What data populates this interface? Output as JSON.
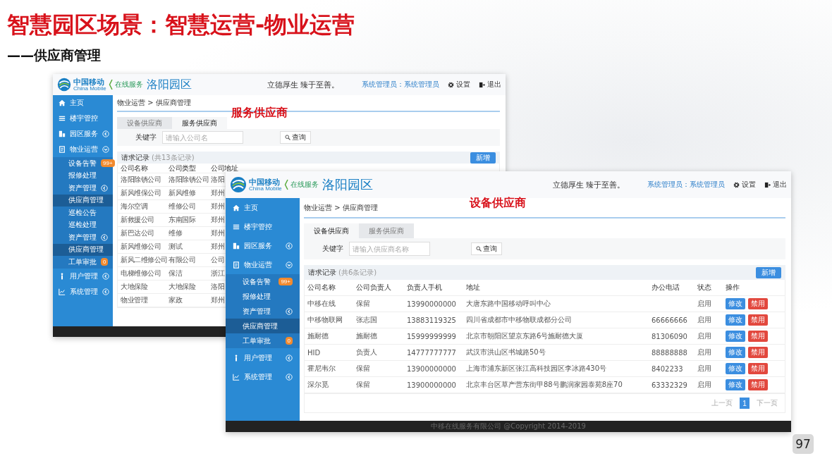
{
  "slide": {
    "title": "智慧园区场景：智慧运营-物业运营",
    "subtitle": "——供应商管理",
    "captions": [
      "服务供应商",
      "设备供应商"
    ],
    "page_number": "97"
  },
  "windows": [
    {
      "brand": {
        "name": "中国移动",
        "name_en": "China Mobile",
        "service": "在线服务",
        "park": "洛阳园区"
      },
      "slogan": "立德厚生 臻于至善。",
      "user": "系统管理员：系统管理员",
      "settings": "设置",
      "logout": "退出",
      "sidebar": [
        {
          "label": "主页",
          "selected": false
        },
        {
          "label": "楼宇管控",
          "selected": false
        },
        {
          "label": "园区服务",
          "selected": false,
          "expanded": false
        },
        {
          "label": "物业运营",
          "selected": false,
          "expanded": true,
          "children": [
            {
              "label": "设备告警",
              "selected": false,
              "badge": "99+"
            },
            {
              "label": "报修处理",
              "selected": false
            },
            {
              "label": "资产管理",
              "selected": false,
              "expanded": false
            },
            {
              "label": "供应商管理",
              "selected": true
            },
            {
              "label": "巡检公告",
              "selected": false
            },
            {
              "label": "巡检处理",
              "selected": false
            },
            {
              "label": "资产管理",
              "selected": false,
              "expanded": false
            },
            {
              "label": "供应商管理",
              "selected": true
            },
            {
              "label": "工单审批",
              "selected": false,
              "badge": "0"
            }
          ]
        },
        {
          "label": "用户管理",
          "selected": false,
          "expanded": false
        },
        {
          "label": "系统管理",
          "selected": false,
          "expanded": false
        }
      ],
      "breadcrumb": "物业运营 > 供应商管理",
      "tabs": [
        {
          "label": "设备供应商",
          "selected": false
        },
        {
          "label": "服务供应商",
          "selected": true
        }
      ],
      "search": {
        "label": "关键字",
        "placeholder": "请输入公司名",
        "button": "查询"
      },
      "records": {
        "title": "请求记录",
        "count": "(共13条记录)",
        "add_button": "新增"
      },
      "table": {
        "columns": [
          "公司名称",
          "公司类型",
          "公司地址"
        ],
        "rows": [
          {
            "cells": [
              "洛阳除锈公司",
              "洛阳除锈公司",
              "洛阳"
            ]
          },
          {
            "cells": [
              "新风维保公司",
              "新风维修",
              "郑州"
            ]
          },
          {
            "cells": [
              "海尔空调",
              "维修公司",
              "郑州"
            ]
          },
          {
            "cells": [
              "新救援公司",
              "东南国际",
              "郑州"
            ]
          },
          {
            "cells": [
              "新巴达公司",
              "维修",
              "郑州"
            ]
          },
          {
            "cells": [
              "新风维修公司",
              "测试",
              "郑州"
            ]
          },
          {
            "cells": [
              "新风二维修公司",
              "有限公司",
              "公司"
            ]
          },
          {
            "cells": [
              "电梯维修公司",
              "保洁",
              "浙江"
            ]
          },
          {
            "cells": [
              "大地保险",
              "大地保险",
              "洛阳"
            ]
          },
          {
            "cells": [
              "物业管理",
              "家政",
              "郑州"
            ]
          }
        ]
      }
    },
    {
      "brand": {
        "name": "中国移动",
        "name_en": "China Mobile",
        "service": "在线服务",
        "park": "洛阳园区"
      },
      "slogan": "立德厚生 臻于至善。",
      "user": "系统管理员：系统管理员",
      "settings": "设置",
      "logout": "退出",
      "sidebar": [
        {
          "label": "主页",
          "selected": false
        },
        {
          "label": "楼宇管控",
          "selected": false
        },
        {
          "label": "园区服务",
          "selected": false,
          "expanded": false
        },
        {
          "label": "物业运营",
          "selected": false,
          "expanded": true,
          "children": [
            {
              "label": "设备告警",
              "selected": false,
              "badge": "99+"
            },
            {
              "label": "报修处理",
              "selected": false
            },
            {
              "label": "资产管理",
              "selected": false,
              "expanded": false
            },
            {
              "label": "供应商管理",
              "selected": true
            },
            {
              "label": "工单审批",
              "selected": false,
              "badge": "0"
            }
          ]
        },
        {
          "label": "用户管理",
          "selected": false,
          "expanded": false
        },
        {
          "label": "系统管理",
          "selected": false,
          "expanded": false
        }
      ],
      "breadcrumb": "物业运营 > 供应商管理",
      "tabs": [
        {
          "label": "设备供应商",
          "selected": true
        },
        {
          "label": "服务供应商",
          "selected": false
        }
      ],
      "search": {
        "label": "关键字",
        "placeholder": "请输入供应商名称",
        "button": "查询"
      },
      "records": {
        "title": "请求记录",
        "count": "(共6条记录)",
        "add_button": "新增"
      },
      "table": {
        "columns": [
          "公司名称",
          "公司负责人",
          "负责人手机",
          "地址",
          "办公电话",
          "状态",
          "操作"
        ],
        "rows": [
          {
            "cells": [
              "中移在线",
              "保留",
              "13990000000",
              "大唐东路中国移动呼叫中心",
              "",
              "启用"
            ],
            "actions": [
              {
                "label": "修改",
                "kind": "edit"
              },
              {
                "label": "禁用",
                "kind": "disable"
              }
            ]
          },
          {
            "cells": [
              "中移物联网",
              "张志国",
              "13883119325",
              "四川省成都市中移物联成都分公司",
              "66666666",
              "启用"
            ],
            "actions": [
              {
                "label": "修改",
                "kind": "edit"
              },
              {
                "label": "禁用",
                "kind": "disable"
              }
            ]
          },
          {
            "cells": [
              "施耐德",
              "施耐德",
              "15999999999",
              "北京市朝阳区望京东路6号施耐德大厦",
              "81306090",
              "启用"
            ],
            "actions": [
              {
                "label": "修改",
                "kind": "edit"
              },
              {
                "label": "禁用",
                "kind": "disable"
              }
            ]
          },
          {
            "cells": [
              "HID",
              "负责人",
              "14777777777",
              "武汉市洪山区书城路50号",
              "88888888",
              "启用"
            ],
            "actions": [
              {
                "label": "修改",
                "kind": "edit"
              },
              {
                "label": "禁用",
                "kind": "disable"
              }
            ]
          },
          {
            "cells": [
              "霍尼韦尔",
              "保留",
              "13900000000",
              "上海市浦东新区张江高科技园区李冰路430号",
              "8402233",
              "启用"
            ],
            "actions": [
              {
                "label": "修改",
                "kind": "edit"
              },
              {
                "label": "禁用",
                "kind": "disable"
              }
            ]
          },
          {
            "cells": [
              "深尔觅",
              "保留",
              "13900000000",
              "北京丰台区草产营东街甲88号鹏润家园泰苑8座70",
              "63332329",
              "启用"
            ],
            "actions": [
              {
                "label": "修改",
                "kind": "edit"
              },
              {
                "label": "禁用",
                "kind": "disable"
              }
            ]
          }
        ]
      },
      "pagination": {
        "prev": "上一页",
        "pages": [
          {
            "label": "1",
            "selected": true
          }
        ],
        "next": "下一页"
      },
      "footer": "中移在线服务有限公司 @Copyright 2014-2019"
    }
  ]
}
